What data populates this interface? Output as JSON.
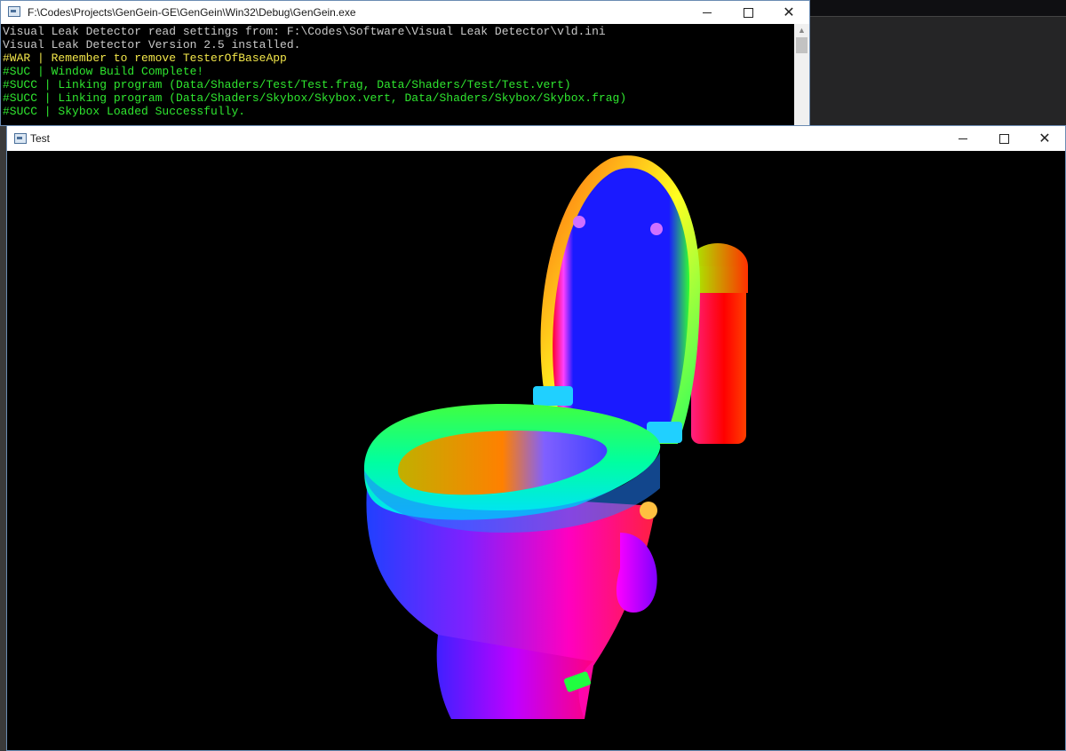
{
  "console_window": {
    "title": "F:\\Codes\\Projects\\GenGein-GE\\GenGein\\Win32\\Debug\\GenGein.exe",
    "lines": [
      {
        "text": "Visual Leak Detector read settings from: F:\\Codes\\Software\\Visual Leak Detector\\vld.ini",
        "color": "#c8c8c8"
      },
      {
        "text": "Visual Leak Detector Version 2.5 installed.",
        "color": "#c8c8c8"
      },
      {
        "text": "#WAR | Remember to remove TesterOfBaseApp",
        "color": "#f2e64a"
      },
      {
        "text": "#SUC | Window Build Complete!",
        "color": "#2fe62f"
      },
      {
        "text": "#SUCC | Linking program (Data/Shaders/Test/Test.frag, Data/Shaders/Test/Test.vert)",
        "color": "#2fe62f"
      },
      {
        "text": "#SUCC | Linking program (Data/Shaders/Skybox/Skybox.vert, Data/Shaders/Skybox/Skybox.frag)",
        "color": "#2fe62f"
      },
      {
        "text": "#SUCC | Skybox Loaded Successfully.",
        "color": "#2fe62f"
      }
    ]
  },
  "render_window": {
    "title": "Test"
  },
  "icons": {
    "minimize": "minimize-icon",
    "maximize": "maximize-icon",
    "close": "close-icon",
    "app": "console-app-icon"
  },
  "colors": {
    "titlebar": "#ffffff",
    "console_bg": "#000000",
    "accent_border": "#6b8cb3"
  }
}
